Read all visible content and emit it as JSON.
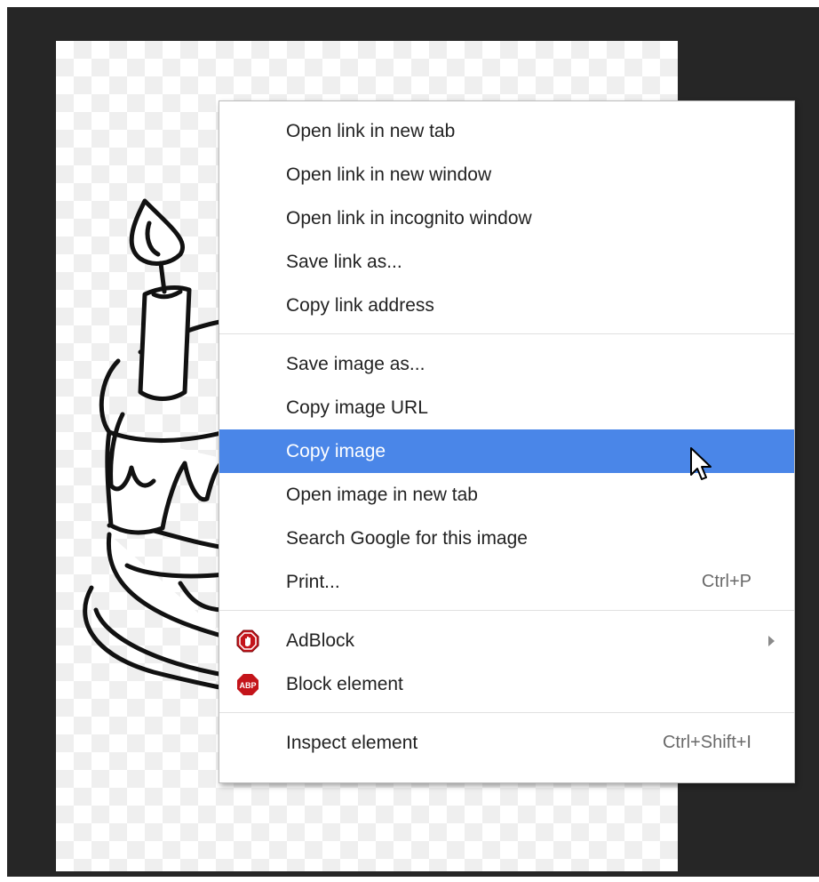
{
  "context_menu": {
    "groups": [
      {
        "items": [
          {
            "label": "Open link in new tab"
          },
          {
            "label": "Open link in new window"
          },
          {
            "label": "Open link in incognito window"
          },
          {
            "label": "Save link as..."
          },
          {
            "label": "Copy link address"
          }
        ]
      },
      {
        "items": [
          {
            "label": "Save image as..."
          },
          {
            "label": "Copy image URL"
          },
          {
            "label": "Copy image",
            "highlighted": true
          },
          {
            "label": "Open image in new tab"
          },
          {
            "label": "Search Google for this image"
          },
          {
            "label": "Print...",
            "shortcut": "Ctrl+P"
          }
        ]
      },
      {
        "items": [
          {
            "label": "AdBlock",
            "icon": "adblock-stop-icon",
            "has_submenu": true
          },
          {
            "label": "Block element",
            "icon": "abp-icon",
            "icon_text": "ABP"
          }
        ]
      },
      {
        "items": [
          {
            "label": "Inspect element",
            "shortcut": "Ctrl+Shift+I"
          }
        ]
      }
    ]
  },
  "colors": {
    "highlight": "#4a86e8",
    "adblock_red": "#c4141a",
    "viewer_background": "#262626"
  }
}
